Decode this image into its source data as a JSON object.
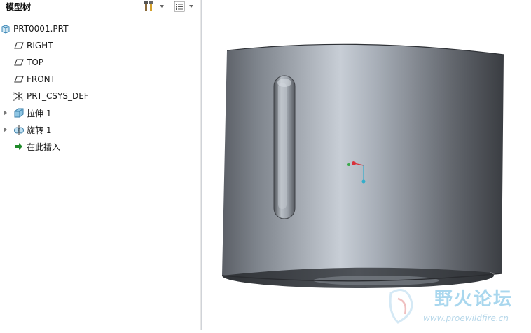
{
  "panel": {
    "title": "模型树"
  },
  "toolbar": {
    "settings_icon": "tools-icon",
    "show_icon": "list-icon"
  },
  "tree": {
    "root": {
      "label": "PRT0001.PRT",
      "icon": "part-icon"
    },
    "items": [
      {
        "label": "RIGHT",
        "icon": "datum-plane-icon"
      },
      {
        "label": "TOP",
        "icon": "datum-plane-icon"
      },
      {
        "label": "FRONT",
        "icon": "datum-plane-icon"
      },
      {
        "label": "PRT_CSYS_DEF",
        "icon": "csys-icon"
      },
      {
        "label": "拉伸 1",
        "icon": "extrude-icon",
        "expandable": true
      },
      {
        "label": "旋转 1",
        "icon": "revolve-icon",
        "expandable": true
      },
      {
        "label": "在此插入",
        "icon": "insert-arrow-icon"
      }
    ]
  },
  "watermark": {
    "text": "野火论坛",
    "url": "www.proewildfire.cn"
  },
  "colors": {
    "model_dark": "#3d4045",
    "model_light": "#c6ccd4",
    "tree_text": "#1a1a1a",
    "watermark": "#a9d7ee"
  }
}
